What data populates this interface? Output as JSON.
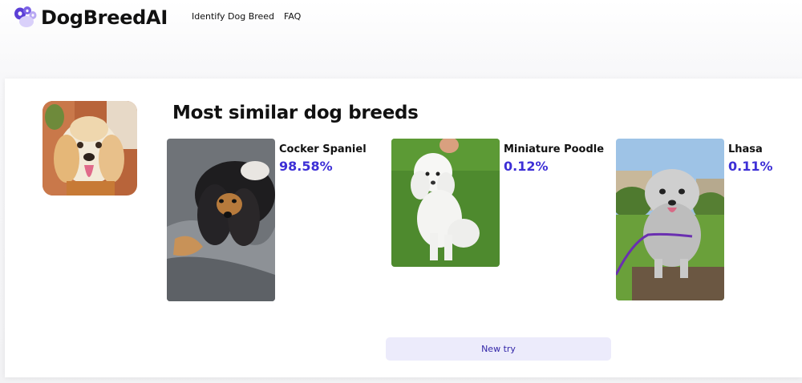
{
  "header": {
    "brand": "DogBreedAI",
    "nav": [
      {
        "label": "Identify Dog Breed"
      },
      {
        "label": "FAQ"
      }
    ],
    "logo_icon": "paw-icon",
    "accent_color": "#5b3fd6"
  },
  "main": {
    "title": "Most similar dog breeds",
    "uploaded_image": "uploaded-dog-photo",
    "results": [
      {
        "breed": "Cocker Spaniel",
        "percent": "98.58%",
        "image": "cocker-spaniel-photo"
      },
      {
        "breed": "Miniature Poodle",
        "percent": "0.12%",
        "image": "miniature-poodle-photo"
      },
      {
        "breed": "Lhasa",
        "percent": "0.11%",
        "image": "lhasa-photo"
      }
    ],
    "new_try_label": "New try",
    "percent_color": "#3d2fd6"
  }
}
